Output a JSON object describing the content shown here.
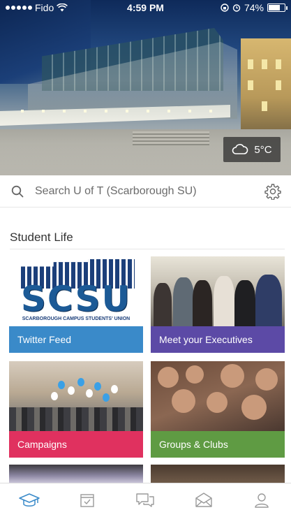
{
  "status_bar": {
    "carrier": "Fido",
    "time": "4:59 PM",
    "battery": "74%",
    "signal_icon": "signal-dots-icon",
    "wifi_icon": "wifi-icon"
  },
  "weather": {
    "temperature": "5°C",
    "icon": "cloud-icon"
  },
  "search": {
    "placeholder": "Search U of T (Scarborough SU)",
    "icon": "search-icon",
    "settings_icon": "gear-icon"
  },
  "section": {
    "title": "Student Life"
  },
  "tiles": [
    {
      "label": "Twitter Feed",
      "color": "#3a8ac9"
    },
    {
      "label": "Meet your Executives",
      "color": "#5c4aa6"
    },
    {
      "label": "Campaigns",
      "color": "#e0315f"
    },
    {
      "label": "Groups & Clubs",
      "color": "#5f9b43"
    }
  ],
  "logo": {
    "text": "SCSU",
    "subtitle": "SCARBOROUGH CAMPUS STUDENTS' UNION"
  },
  "tabbar": {
    "items": [
      {
        "icon": "graduation-cap-icon",
        "active": true
      },
      {
        "icon": "calendar-check-icon",
        "active": false
      },
      {
        "icon": "chat-bubbles-icon",
        "active": false
      },
      {
        "icon": "envelope-icon",
        "active": false
      },
      {
        "icon": "person-icon",
        "active": false
      }
    ]
  },
  "colors": {
    "accent": "#3a8ac9",
    "inactive_icon": "#9a9a9a"
  }
}
